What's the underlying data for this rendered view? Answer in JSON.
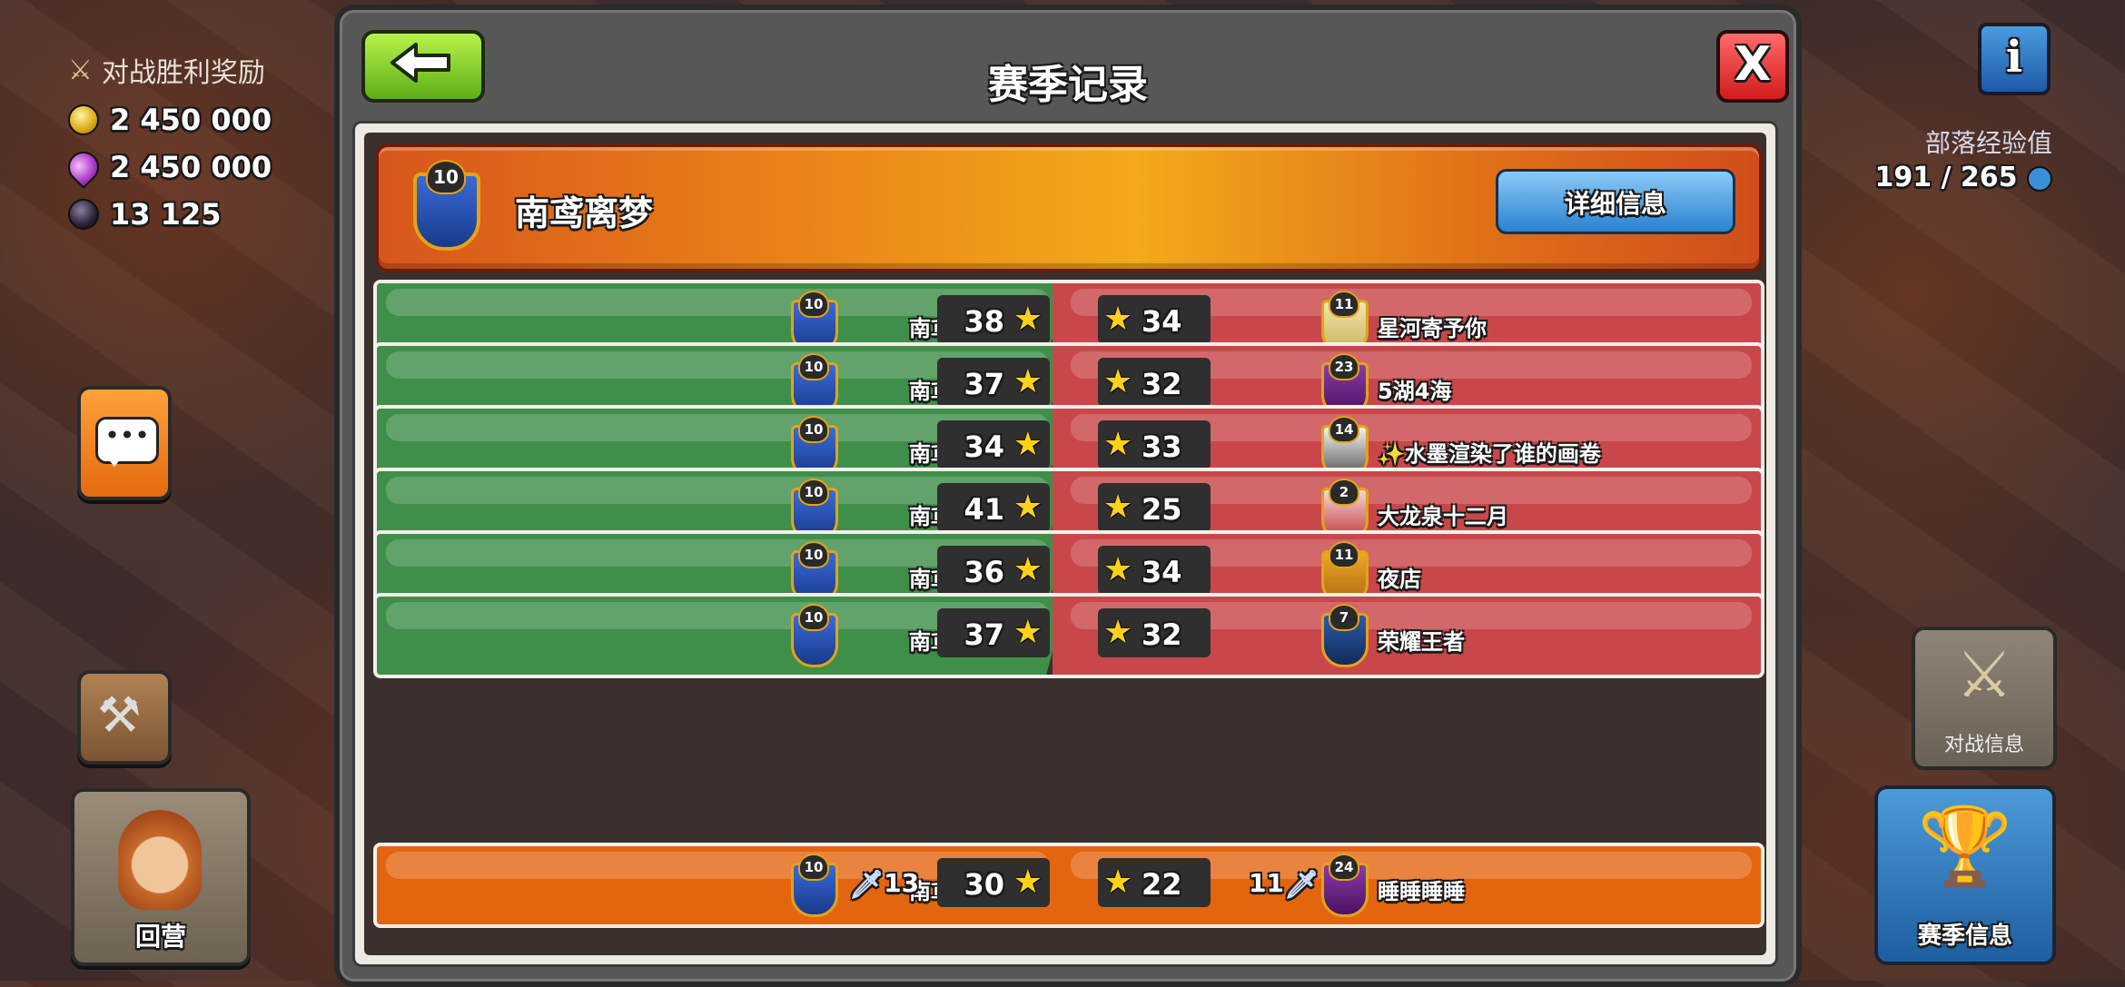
{
  "hud": {
    "war_win_bonus_label": "对战胜利奖励",
    "resources": [
      {
        "type": "gold",
        "value": "2 450 000"
      },
      {
        "type": "elixir",
        "value": "2 450 000"
      },
      {
        "type": "dark-elixir",
        "value": "13 125"
      }
    ],
    "clan_xp_label": "部落经验值",
    "clan_xp_value": "191 / 265",
    "return_home_label": "回营",
    "war_info_label": "对战信息",
    "season_info_label": "赛季信息",
    "info_glyph": "i"
  },
  "dialog": {
    "title": "赛季记录",
    "close_glyph": "X",
    "clan_name": "南鸢离梦",
    "clan_level": "10",
    "details_button": "详细信息"
  },
  "wars": [
    {
      "our_name": "南鸢离梦",
      "our_level": "10",
      "our_stars": "38",
      "opp_stars": "34",
      "opp_name": "星河寄予你",
      "opp_level": "11",
      "result": "win"
    },
    {
      "our_name": "南鸢离梦",
      "our_level": "10",
      "our_stars": "37",
      "opp_stars": "32",
      "opp_name": "5湖4海",
      "opp_level": "23",
      "result": "win"
    },
    {
      "our_name": "南鸢离梦",
      "our_level": "10",
      "our_stars": "34",
      "opp_stars": "33",
      "opp_name": "✨水墨渲染了谁的画卷",
      "opp_level": "14",
      "result": "win"
    },
    {
      "our_name": "南鸢离梦",
      "our_level": "10",
      "our_stars": "41",
      "opp_stars": "25",
      "opp_name": "大龙泉十二月",
      "opp_level": "2",
      "result": "win"
    },
    {
      "our_name": "南鸢离梦",
      "our_level": "10",
      "our_stars": "36",
      "opp_stars": "34",
      "opp_name": "夜店",
      "opp_level": "11",
      "result": "win"
    },
    {
      "our_name": "南鸢离梦",
      "our_level": "10",
      "our_stars": "37",
      "opp_stars": "32",
      "opp_name": "荣耀王者",
      "opp_level": "7",
      "result": "win"
    }
  ],
  "current_war": {
    "our_name": "南鸢离梦",
    "our_level": "10",
    "our_attacks": "13",
    "our_stars": "30",
    "opp_stars": "22",
    "opp_attacks": "11",
    "opp_name": "睡睡睡睡",
    "opp_level": "24"
  },
  "colors": {
    "win_green": "#3f8f4a",
    "loss_red": "#c9474a",
    "current_orange": "#e4650f",
    "star_gold": "#ffd21a"
  }
}
